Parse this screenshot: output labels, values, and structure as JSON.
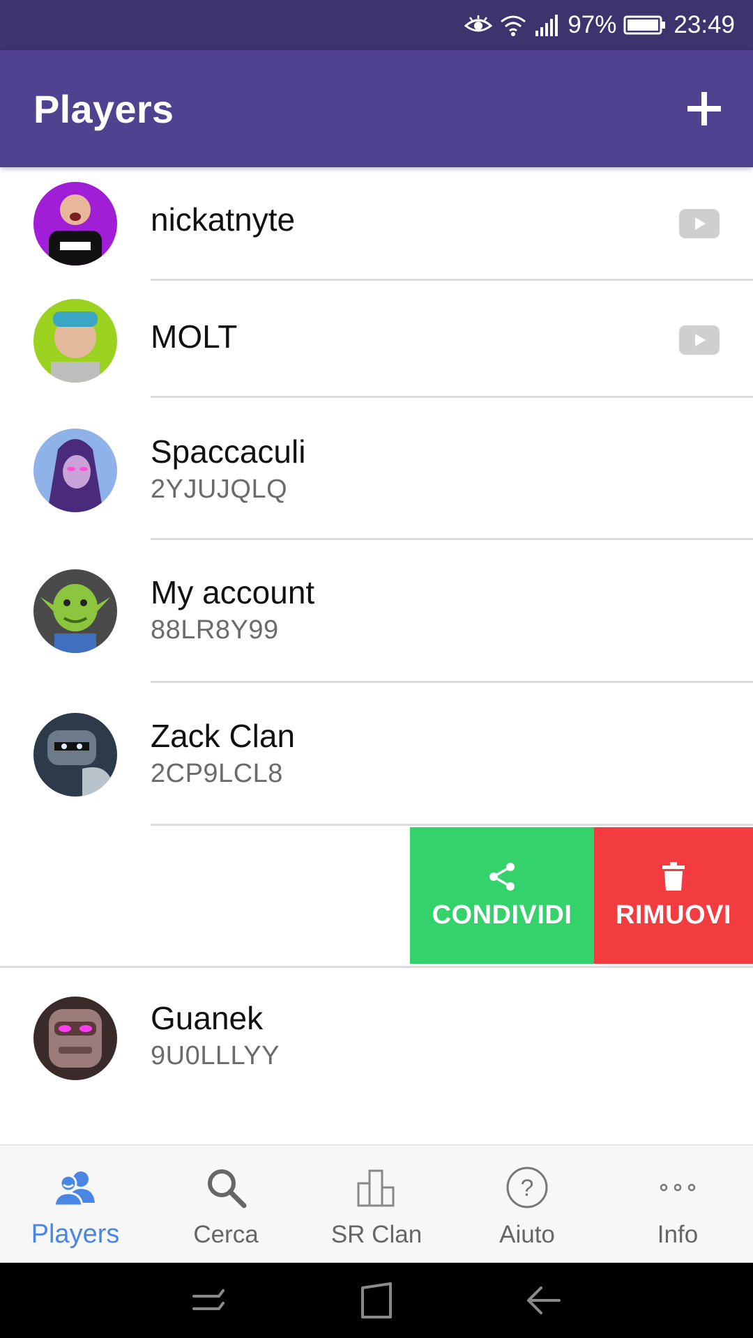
{
  "status_bar": {
    "battery": "97%",
    "time": "23:49"
  },
  "app_bar": {
    "title": "Players"
  },
  "players": [
    {
      "name": "nickatnyte",
      "tag": "",
      "youtube": true
    },
    {
      "name": "MOLT",
      "tag": "",
      "youtube": true
    },
    {
      "name": "Spaccaculi",
      "tag": "2YJUJQLQ",
      "youtube": false
    },
    {
      "name": "My account",
      "tag": "88LR8Y99",
      "youtube": false
    },
    {
      "name": "Zack Clan",
      "tag": "2CP9LCL8",
      "youtube": false
    },
    {
      "name": "Guanek",
      "tag": "9U0LLLYY",
      "youtube": false
    }
  ],
  "swipe_actions": {
    "share_label": "CONDIVIDI",
    "remove_label": "RIMUOVI"
  },
  "bottom_nav": [
    {
      "label": "Players",
      "icon": "users-icon",
      "active": true
    },
    {
      "label": "Cerca",
      "icon": "search-icon",
      "active": false
    },
    {
      "label": "SR Clan",
      "icon": "bar-chart-icon",
      "active": false
    },
    {
      "label": "Aiuto",
      "icon": "help-icon",
      "active": false
    },
    {
      "label": "Info",
      "icon": "more-icon",
      "active": false
    }
  ],
  "colors": {
    "status_bar": "#3d336d",
    "app_bar": "#514191",
    "share": "#33d26a",
    "remove": "#f33c3f",
    "nav_active": "#4a87e5"
  }
}
